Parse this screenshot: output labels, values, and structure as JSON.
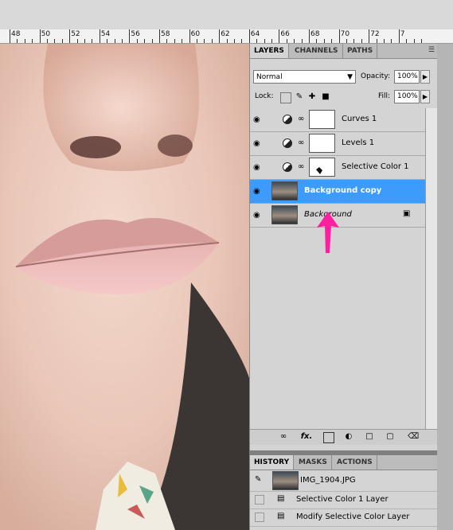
{
  "ruler": {
    "labels": [
      "48",
      "50",
      "52",
      "54",
      "56",
      "58",
      "60",
      "62",
      "64",
      "66",
      "68",
      "70",
      "72",
      "7"
    ]
  },
  "layers_panel": {
    "tabs": [
      "LAYERS",
      "CHANNELS",
      "PATHS"
    ],
    "blend_mode": "Normal",
    "opacity_label": "Opacity:",
    "opacity_value": "100%",
    "lock_label": "Lock:",
    "fill_label": "Fill:",
    "fill_value": "100%",
    "layers": [
      {
        "name": "Curves 1"
      },
      {
        "name": "Levels 1"
      },
      {
        "name": "Selective Color 1"
      },
      {
        "name": "Background copy"
      },
      {
        "name": "Background"
      }
    ],
    "bottom_fx": "fx."
  },
  "history_panel": {
    "tabs": [
      "HISTORY",
      "MASKS",
      "ACTIONS"
    ],
    "snapshot": "IMG_1904.JPG",
    "items": [
      "Selective Color 1 Layer",
      "Modify Selective Color Layer"
    ]
  },
  "colors": {
    "selection": "#3d9cfb",
    "annotation_arrow": "#ff1fa0"
  },
  "icons": [
    "eye-icon",
    "adjustment-icon",
    "link-icon",
    "lock-icon",
    "pencil-icon",
    "move-icon",
    "trash-icon"
  ]
}
